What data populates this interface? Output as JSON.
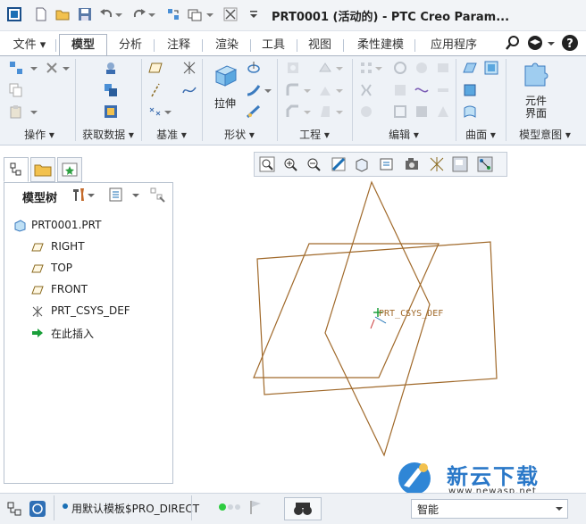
{
  "window": {
    "title": "PRT0001 (活动的) - PTC Creo Param..."
  },
  "tabs": [
    {
      "label": "文件",
      "has_menu": true
    },
    {
      "label": "模型",
      "active": true
    },
    {
      "label": "分析"
    },
    {
      "label": "注释"
    },
    {
      "label": "渲染"
    },
    {
      "label": "工具"
    },
    {
      "label": "视图"
    },
    {
      "label": "柔性建模"
    },
    {
      "label": "应用程序"
    }
  ],
  "ribbon": {
    "groups": [
      {
        "label": "操作",
        "has_menu": true
      },
      {
        "label": "获取数据",
        "has_menu": true
      },
      {
        "label": "基准",
        "has_menu": true
      },
      {
        "label": "形状",
        "has_menu": true
      },
      {
        "label": "工程",
        "has_menu": true
      },
      {
        "label": "编辑",
        "has_menu": true
      },
      {
        "label": "曲面",
        "has_menu": true
      },
      {
        "label": "模型意图",
        "has_menu": true
      }
    ],
    "extrude_label": "拉伸",
    "component_interface_label_1": "元件",
    "component_interface_label_2": "界面"
  },
  "model_tree": {
    "header_label": "模型树",
    "items": [
      {
        "label": "PRT0001.PRT",
        "icon": "part-icon"
      },
      {
        "label": "RIGHT",
        "icon": "datum-plane-icon"
      },
      {
        "label": "TOP",
        "icon": "datum-plane-icon"
      },
      {
        "label": "FRONT",
        "icon": "datum-plane-icon"
      },
      {
        "label": "PRT_CSYS_DEF",
        "icon": "csys-icon"
      },
      {
        "label": "在此插入",
        "icon": "insert-arrow-icon"
      }
    ]
  },
  "graphics": {
    "csys_label": "PRT_CSYS_DEF",
    "plane_color": "#a0692a"
  },
  "status": {
    "message": "用默认模板$PRO_DIRECT",
    "filter_value": "智能"
  },
  "watermark": {
    "brand": "新云下载",
    "url": "www.newasp.net"
  },
  "colors": {
    "accent": "#1a6fb5",
    "ribbon_bg": "#eef2f7"
  }
}
